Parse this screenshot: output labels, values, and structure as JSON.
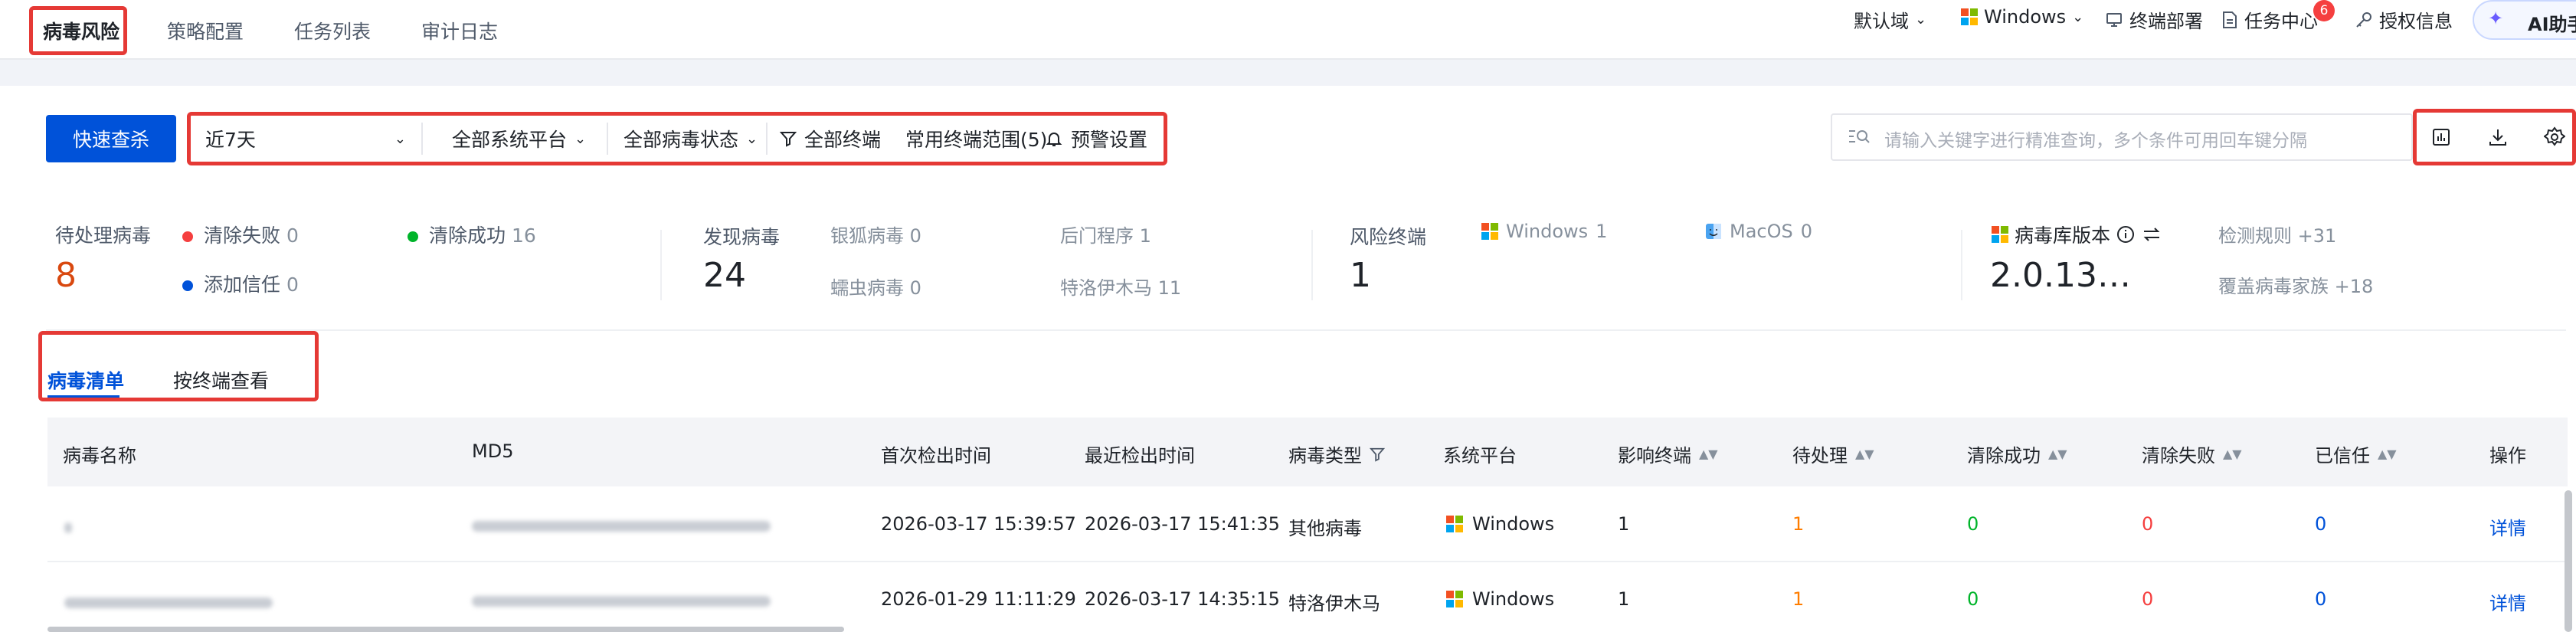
{
  "top_tabs": [
    "病毒风险",
    "策略配置",
    "任务列表",
    "审计日志"
  ],
  "topnav": {
    "domain": "默认域",
    "platform": "Windows",
    "deploy": "终端部署",
    "task_center": "任务中心",
    "task_badge": "6",
    "license": "授权信息",
    "ai": "AI助手"
  },
  "toolbar": {
    "quick_check": "快速查杀",
    "time_range": "近7天",
    "os_filter": "全部系统平台",
    "virus_status": "全部病毒状态",
    "all_terminals": "全部终端",
    "common_scope": "常用终端范围(5)",
    "alert_settings": "预警设置",
    "search_placeholder": "请输入关键字进行精准查询，多个条件可用回车键分隔"
  },
  "stats": {
    "pending": {
      "label": "待处理病毒",
      "value": "8"
    },
    "clear_failed": {
      "label": "清除失败",
      "count": "0"
    },
    "clear_success": {
      "label": "清除成功",
      "count": "16"
    },
    "trusted": {
      "label": "添加信任",
      "count": "0"
    },
    "found": {
      "label": "发现病毒",
      "value": "24"
    },
    "silverfox": {
      "label": "银狐病毒",
      "count": "0"
    },
    "backdoor": {
      "label": "后门程序",
      "count": "1"
    },
    "worm": {
      "label": "蠕虫病毒",
      "count": "0"
    },
    "trojan": {
      "label": "特洛伊木马",
      "count": "11"
    },
    "risk_terminals": {
      "label": "风险终端",
      "value": "1"
    },
    "windows": {
      "label": "Windows",
      "count": "1"
    },
    "macos": {
      "label": "MacOS",
      "count": "0"
    },
    "db_version": {
      "label": "病毒库版本",
      "value": "2.0.13…"
    },
    "detect_rules": {
      "label": "检测规则",
      "count": "+31"
    },
    "families": {
      "label": "覆盖病毒家族",
      "count": "+18"
    }
  },
  "sub_tabs": [
    "病毒清单",
    "按终端查看"
  ],
  "table": {
    "columns": [
      "病毒名称",
      "MD5",
      "首次检出时间",
      "最近检出时间",
      "病毒类型",
      "系统平台",
      "影响终端",
      "待处理",
      "清除成功",
      "清除失败",
      "已信任",
      "操作"
    ],
    "rows": [
      {
        "first": "2026-03-17 15:39:57",
        "last": "2026-03-17 15:41:35",
        "type": "其他病毒",
        "os": "Windows",
        "affected": "1",
        "pending": "1",
        "success": "0",
        "failed": "0",
        "trusted": "0",
        "action": "详情"
      },
      {
        "first": "2026-01-29 11:11:29",
        "last": "2026-03-17 14:35:15",
        "type": "特洛伊木马",
        "os": "Windows",
        "affected": "1",
        "pending": "1",
        "success": "0",
        "failed": "0",
        "trusted": "0",
        "action": "详情"
      }
    ]
  },
  "colors": {
    "primary": "#0052d9",
    "pending": "#ff7d00",
    "success": "#00b42a",
    "failed": "#f53f3f",
    "trusted": "#0052d9",
    "highlight_box": "#e53935"
  }
}
